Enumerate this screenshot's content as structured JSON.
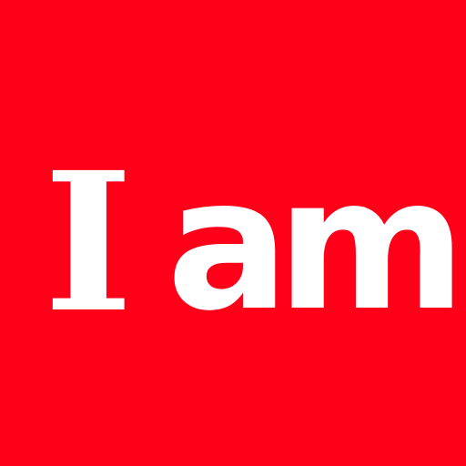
{
  "background_color": "#ff0019",
  "text_color": "#ffffff",
  "headline": {
    "word1": "I",
    "word2": "am"
  }
}
